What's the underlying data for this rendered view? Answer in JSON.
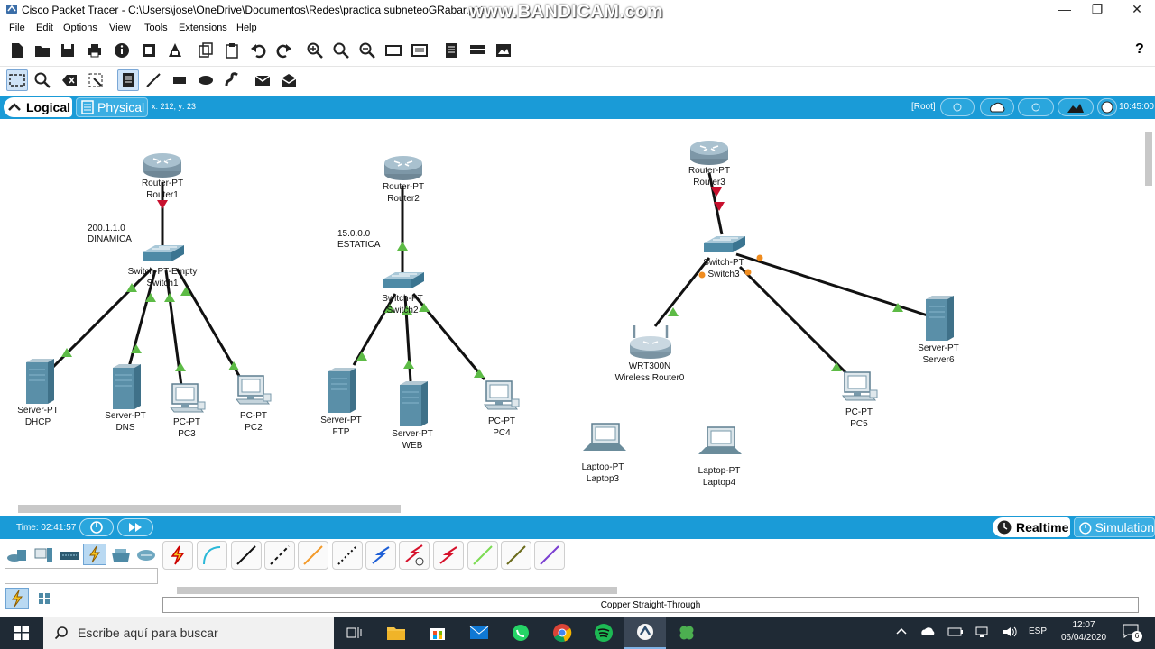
{
  "window": {
    "title": "Cisco Packet Tracer - C:\\Users\\jose\\OneDrive\\Documentos\\Redes\\practica subneteoGRabar.pkt",
    "watermark": "www.BANDICAM.com",
    "minimize": "—",
    "maximize": "❐",
    "close": "✕"
  },
  "menu": [
    "File",
    "Edit",
    "Options",
    "View",
    "Tools",
    "Extensions",
    "Help"
  ],
  "help_icon": "?",
  "workspace": {
    "logical_label": "Logical",
    "physical_label": "Physical",
    "coords": "x: 212, y: 23",
    "root_label": "[Root]",
    "clock": "10:45:00"
  },
  "devices": [
    {
      "id": "router1",
      "type": "router",
      "line1": "Router-PT",
      "line2": "Router1"
    },
    {
      "id": "router2",
      "type": "router",
      "line1": "Router-PT",
      "line2": "Router2"
    },
    {
      "id": "router3",
      "type": "router",
      "line1": "Router-PT",
      "line2": "Router3"
    },
    {
      "id": "switch1",
      "type": "switch",
      "line1": "Switch-PT-Empty",
      "line2": "Switch1"
    },
    {
      "id": "switch2",
      "type": "switch",
      "line1": "Switch-PT",
      "line2": "Switch2"
    },
    {
      "id": "switch3",
      "type": "switch",
      "line1": "Switch-PT",
      "line2": "Switch3"
    },
    {
      "id": "dhcp",
      "type": "server",
      "line1": "Server-PT",
      "line2": "DHCP"
    },
    {
      "id": "dns",
      "type": "server",
      "line1": "Server-PT",
      "line2": "DNS"
    },
    {
      "id": "pc3",
      "type": "pc",
      "line1": "PC-PT",
      "line2": "PC3"
    },
    {
      "id": "pc2",
      "type": "pc",
      "line1": "PC-PT",
      "line2": "PC2"
    },
    {
      "id": "ftp",
      "type": "server",
      "line1": "Server-PT",
      "line2": "FTP"
    },
    {
      "id": "web",
      "type": "server",
      "line1": "Server-PT",
      "line2": "WEB"
    },
    {
      "id": "pc4",
      "type": "pc",
      "line1": "PC-PT",
      "line2": "PC4"
    },
    {
      "id": "wrouter0",
      "type": "wireless",
      "line1": "WRT300N",
      "line2": "Wireless Router0"
    },
    {
      "id": "pc5",
      "type": "pc",
      "line1": "PC-PT",
      "line2": "PC5"
    },
    {
      "id": "server6",
      "type": "server",
      "line1": "Server-PT",
      "line2": "Server6"
    },
    {
      "id": "laptop3",
      "type": "laptop",
      "line1": "Laptop-PT",
      "line2": "Laptop3"
    },
    {
      "id": "laptop4",
      "type": "laptop",
      "line1": "Laptop-PT",
      "line2": "Laptop4"
    }
  ],
  "notes": [
    {
      "id": "note1",
      "line1": "200.1.1.0",
      "line2": "DINAMICA"
    },
    {
      "id": "note2",
      "line1": "15.0.0.0",
      "line2": "ESTATICA"
    }
  ],
  "simbar": {
    "time_label": "Time: 02:41:57",
    "realtime_label": "Realtime",
    "simulation_label": "Simulation"
  },
  "palette": {
    "selected_cable_name": "Copper Straight-Through",
    "cables": [
      "auto-connection",
      "console",
      "copper-straight-through",
      "copper-cross-over",
      "fiber",
      "phone",
      "coaxial",
      "serial-dce",
      "serial-dte",
      "octal",
      "iot",
      "usb"
    ]
  },
  "taskbar": {
    "search_placeholder": "Escribe aquí para buscar",
    "language": "ESP",
    "time": "12:07",
    "date": "06/04/2020",
    "notifications": "6"
  },
  "colors": {
    "accent_blue": "#1a9bd7",
    "link_up": "#5dbb46",
    "link_down": "#c8102e",
    "link_orange": "#f08c1e"
  }
}
